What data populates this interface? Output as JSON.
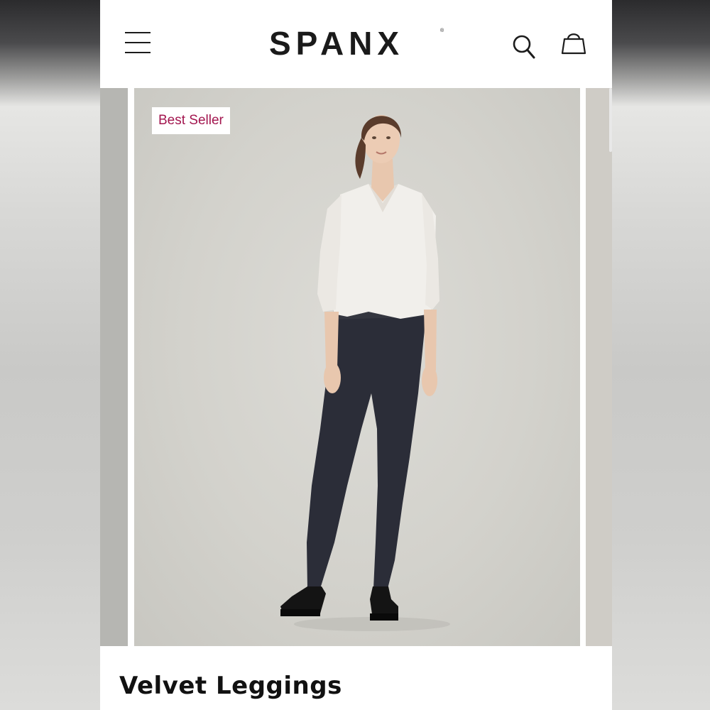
{
  "header": {
    "logo_text": "SPANX",
    "logo_mark": "®",
    "menu_icon": "hamburger-menu-icon",
    "search_icon": "search-icon",
    "bag_icon": "shopping-bag-icon"
  },
  "gallery": {
    "badge": "Best Seller",
    "badge_color": "#a3164f",
    "main_image": "model-wearing-white-sweater-and-navy-velvet-leggings"
  },
  "product": {
    "title": "Velvet Leggings"
  }
}
